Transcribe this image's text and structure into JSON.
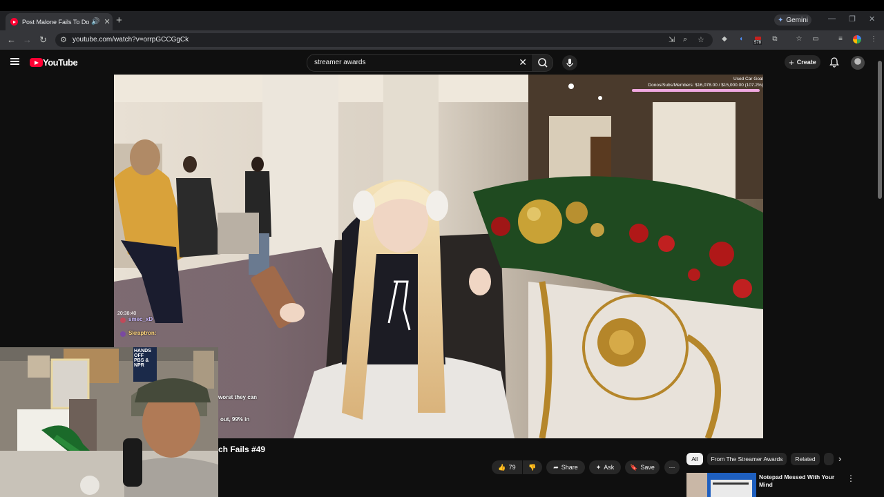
{
  "browser": {
    "tab_title": "Post Malone Fails To Do A Backflip",
    "new_tab": "+",
    "gemini_label": "Gemini",
    "url": "youtube.com/watch?v=orrpGCCGgCk",
    "extension_badge": "578"
  },
  "youtube": {
    "logo_text": "YouTube",
    "search_value": "streamer awards",
    "create_label": "Create"
  },
  "stream": {
    "goal_title": "Used Car Goal",
    "goal_text": "Donos/Subs/Members: $16,078.00 / $15,000.00 (107.2%)",
    "goal_progress": 1.0,
    "timestamp": "20:38:40",
    "chat": [
      {
        "user": "smec_xD"
      },
      {
        "user": "Skraptron:"
      }
    ],
    "caption_lines": [
      "worst they can",
      "out, 99% in"
    ]
  },
  "video": {
    "title": "ch Fails #49",
    "likes": "79",
    "share_label": "Share",
    "ask_label": "Ask",
    "save_label": "Save"
  },
  "sidebar": {
    "chips": [
      "All",
      "From The Streamer Awards",
      "Related"
    ],
    "recommended": [
      {
        "title": "Notepad Messed With Your Mind"
      }
    ]
  },
  "webcam_poster": {
    "line1": "HANDS",
    "line2": "OFF",
    "line3": "PBS &",
    "line4": "NPR"
  },
  "colors": {
    "brand_red": "#ff0033",
    "goal_bar": "#f0a8e0",
    "background": "#0f0f0f"
  }
}
